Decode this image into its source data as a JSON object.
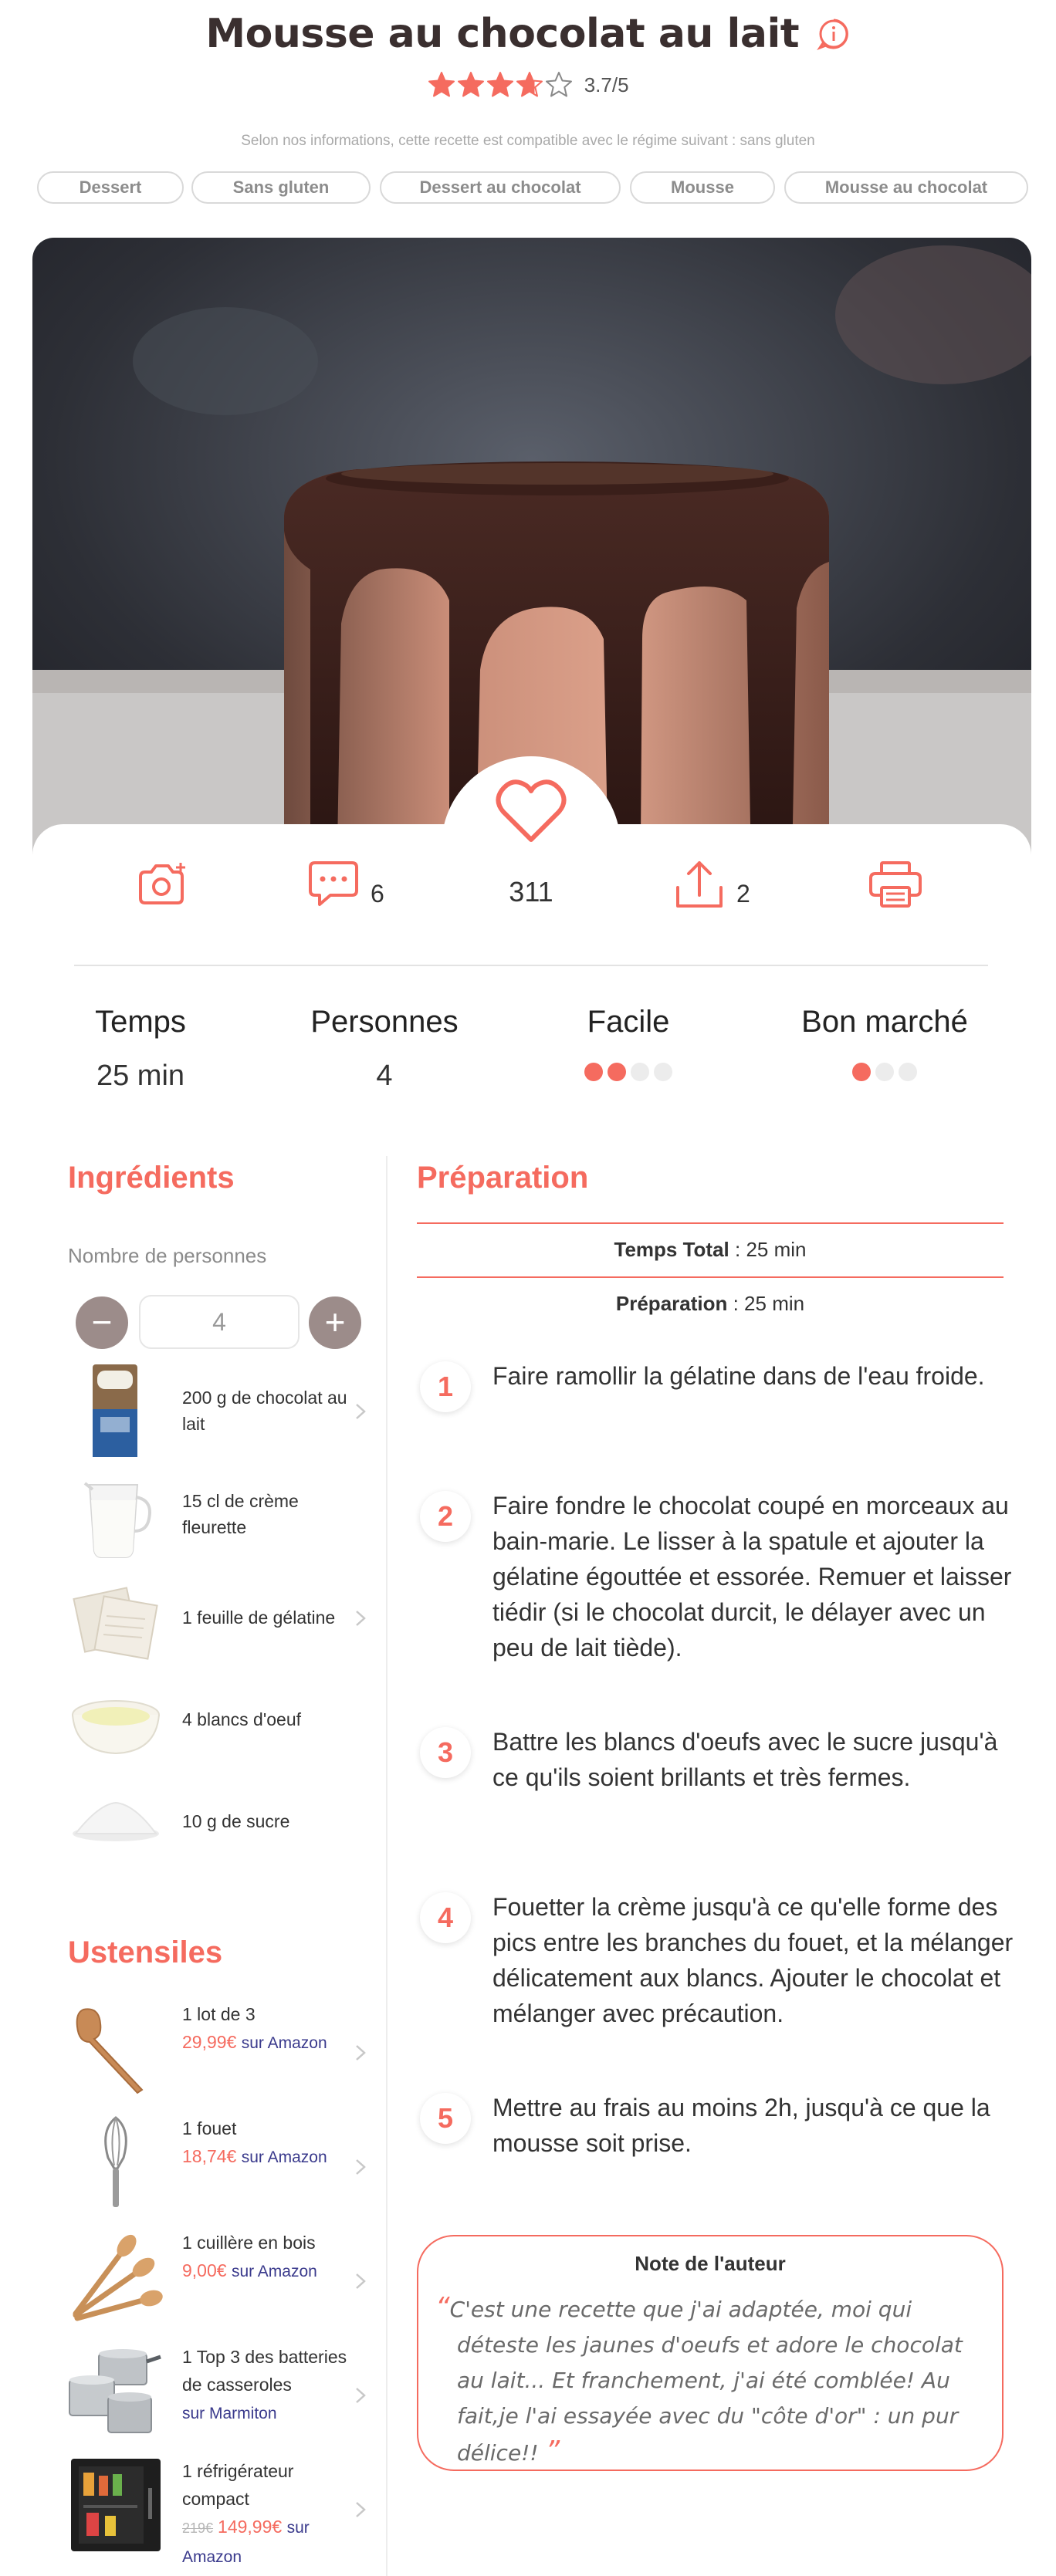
{
  "recipe": {
    "title": "Mousse au chocolat au lait",
    "rating": "3.7/5",
    "rating_value": 3.7,
    "rating_max": 5,
    "diet_note": "Selon nos informations, cette recette est compatible avec le régime suivant : sans gluten"
  },
  "tags": [
    "Dessert",
    "Sans gluten",
    "Dessert au chocolat",
    "Mousse",
    "Mousse au chocolat"
  ],
  "actions": {
    "comments_count": "6",
    "likes_count": "311",
    "shares_count": "2"
  },
  "stats": [
    {
      "label": "Temps",
      "value": "25 min"
    },
    {
      "label": "Personnes",
      "value": "4"
    },
    {
      "label": "Facile",
      "level": 2,
      "max": 4
    },
    {
      "label": "Bon marché",
      "level": 1,
      "max": 3
    }
  ],
  "ingredients": {
    "heading": "Ingrédients",
    "persons_label": "Nombre de personnes",
    "persons_value": "4",
    "minus_symbol": "−",
    "plus_symbol": "+",
    "items": [
      {
        "text": "200 g de chocolat au lait",
        "icon": "chocolate-bar-icon"
      },
      {
        "text": "15 cl de crème fleurette",
        "icon": "cream-jug-icon"
      },
      {
        "text": "1 feuille de gélatine",
        "icon": "gelatin-sheet-icon"
      },
      {
        "text": "4 blancs d'oeuf",
        "icon": "egg-white-bowl-icon"
      },
      {
        "text": "10 g de sucre",
        "icon": "sugar-pile-icon"
      }
    ]
  },
  "utensils": {
    "heading": "Ustensiles",
    "items": [
      {
        "name": "1 lot de 3",
        "price": "29,99€",
        "old_price": "",
        "vendor": "sur Amazon",
        "icon": "spatula-icon"
      },
      {
        "name": "1 fouet",
        "price": "18,74€",
        "old_price": "",
        "vendor": "sur Amazon",
        "icon": "whisk-icon"
      },
      {
        "name": "1 cuillère en bois",
        "price": "9,00€",
        "old_price": "",
        "vendor": "sur Amazon",
        "icon": "wooden-spoons-icon"
      },
      {
        "name": "1 Top 3 des batteries de casseroles",
        "price": "",
        "old_price": "",
        "vendor": "sur Marmiton",
        "icon": "saucepans-icon"
      },
      {
        "name": "1 réfrigérateur compact",
        "price": "149,99€",
        "old_price": "219€",
        "vendor": "sur Amazon",
        "icon": "fridge-icon"
      }
    ]
  },
  "preparation": {
    "heading": "Préparation",
    "total_label": "Temps Total",
    "total_value": " : 25 min",
    "prep_label": "Préparation",
    "prep_value": " : 25 min",
    "steps": [
      {
        "num": "1",
        "text": "Faire ramollir la gélatine dans de l'eau froide."
      },
      {
        "num": "2",
        "text": "Faire fondre le chocolat coupé en morceaux au bain-marie. Le lisser à la spatule et ajouter la gélatine égouttée et essorée. Remuer et laisser tiédir (si le chocolat durcit, le délayer avec un peu de lait tiède)."
      },
      {
        "num": "3",
        "text": "Battre les blancs d'oeufs avec le sucre jusqu'à ce qu'ils soient brillants et très fermes."
      },
      {
        "num": "4",
        "text": "Fouetter la crème jusqu'à ce qu'elle forme des pics entre les branches du fouet, et la mélanger délicatement aux blancs. Ajouter le chocolat et mélanger avec précaution."
      },
      {
        "num": "5",
        "text": "Mettre au frais au moins 2h, jusqu'à ce que la mousse soit prise."
      }
    ]
  },
  "author_note": {
    "title": "Note de l'auteur",
    "open_quote": "“",
    "close_quote": "”",
    "text": "C'est une recette que j'ai adaptée, moi qui déteste les jaunes d'oeufs et adore le chocolat au lait... Et franchement, j'ai été comblée! Au fait,je l'ai essayée avec du \"côte d'or\" : un pur délice!!"
  },
  "colors": {
    "accent": "#f56b5f",
    "title": "#3a2f2f",
    "stepper": "#9c8c8a"
  }
}
